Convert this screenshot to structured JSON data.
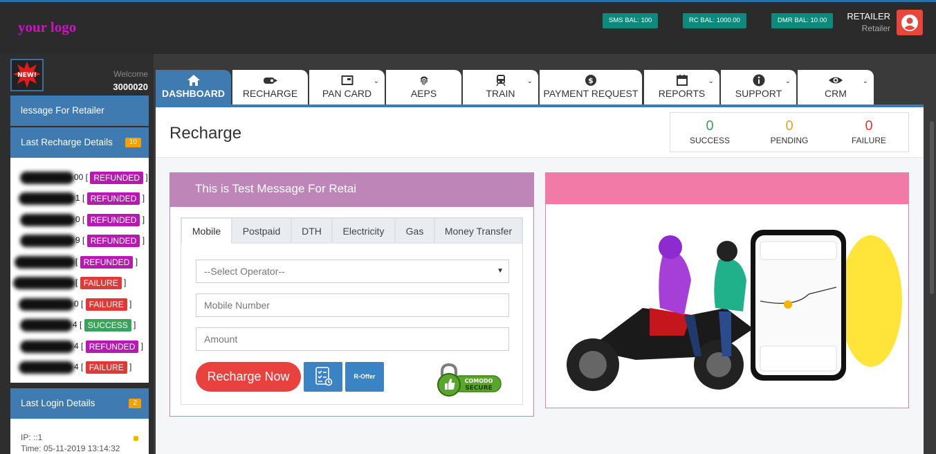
{
  "header": {
    "logo_text": "your logo",
    "balances": [
      {
        "label": "SMS BAL: 100"
      },
      {
        "label": "RC BAL: 1000.00"
      },
      {
        "label": "DMR BAL: 10.00"
      }
    ],
    "user_name": "RETAILER",
    "user_role": "Retailer"
  },
  "sidebar": {
    "new_badge": "NEW!",
    "welcome_label": "Welcome",
    "welcome_id": "3000020",
    "message_header": "lessage For Retailer",
    "recharge_header": "Last Recharge Details",
    "recharge_count": "10",
    "recharges": [
      {
        "suffix": "00 [",
        "status": "REFUNDED",
        "class": "refunded"
      },
      {
        "suffix": "1 [",
        "status": "REFUNDED",
        "class": "refunded"
      },
      {
        "suffix": "0 [",
        "status": "REFUNDED",
        "class": "refunded"
      },
      {
        "suffix": "9 [",
        "status": "REFUNDED",
        "class": "refunded"
      },
      {
        "suffix": "[",
        "status": "REFUNDED",
        "class": "refunded"
      },
      {
        "suffix": "[",
        "status": "FAILURE",
        "class": "failure"
      },
      {
        "suffix": "0 [",
        "status": "FAILURE",
        "class": "failure"
      },
      {
        "suffix": "4 [",
        "status": "SUCCESS",
        "class": "success"
      },
      {
        "suffix": "4 [",
        "status": "REFUNDED",
        "class": "refunded"
      },
      {
        "suffix": "4 [",
        "status": "FAILURE",
        "class": "failure"
      }
    ],
    "login_header": "Last Login Details",
    "login_count": "2",
    "login_ip": "IP: ::1",
    "login_time": "Time: 05-11-2019 13:14:32"
  },
  "nav": {
    "tabs": [
      {
        "label": "DASHBOARD",
        "icon": "home-icon"
      },
      {
        "label": "RECHARGE",
        "icon": "recharge-icon"
      },
      {
        "label": "PAN CARD",
        "icon": "card-icon"
      },
      {
        "label": "AEPS",
        "icon": "fingerprint-icon"
      },
      {
        "label": "TRAIN",
        "icon": "train-icon"
      },
      {
        "label": "PAYMENT REQUEST",
        "icon": "dollar-icon"
      },
      {
        "label": "REPORTS",
        "icon": "calendar-icon"
      },
      {
        "label": "SUPPORT",
        "icon": "info-icon"
      },
      {
        "label": "CRM",
        "icon": "eye-icon"
      }
    ]
  },
  "page": {
    "title": "Recharge",
    "stats": [
      {
        "value": "0",
        "label": "SUCCESS",
        "color": "#3aa25c"
      },
      {
        "value": "0",
        "label": "PENDING",
        "color": "#f0a020"
      },
      {
        "value": "0",
        "label": "FAILURE",
        "color": "#e03a36"
      }
    ]
  },
  "recharge_panel": {
    "message": "This is Test Message For Retai",
    "tabs": [
      "Mobile",
      "Postpaid",
      "DTH",
      "Electricity",
      "Gas",
      "Money Transfer"
    ],
    "operator_placeholder": "--Select Operator--",
    "mobile_placeholder": "Mobile Number",
    "amount_placeholder": "Amount",
    "recharge_button": "Recharge Now",
    "roffer_button": "R-Offer",
    "secure_badge_top": "COMODO",
    "secure_badge_bottom": "SECURE"
  },
  "colors": {
    "accent": "#3f7bb0",
    "message_bar": "#be86b8",
    "image_bar": "#f27aa7",
    "balance_badge": "#0e8a7c"
  }
}
